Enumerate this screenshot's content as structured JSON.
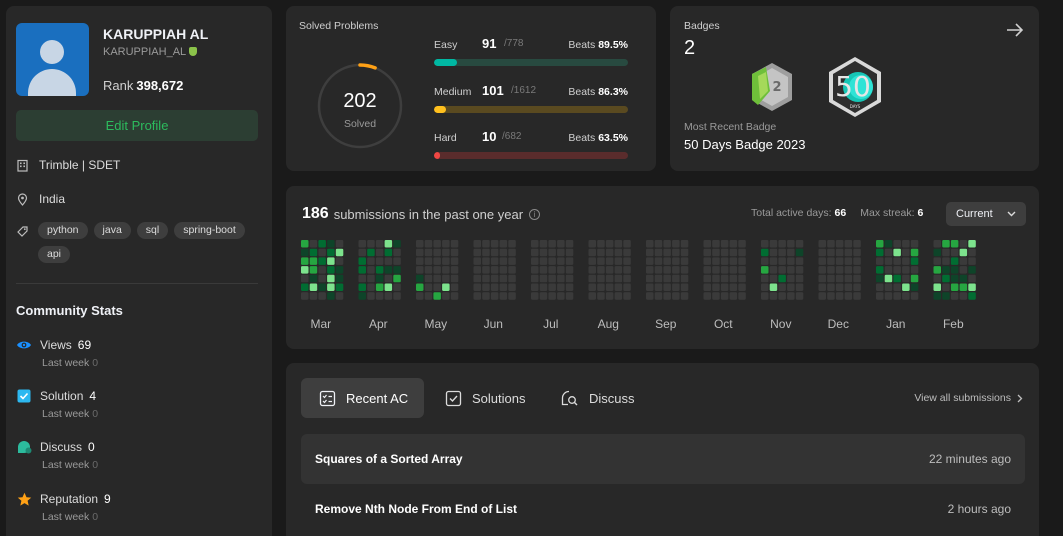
{
  "profile": {
    "name": "KARUPPIAH AL",
    "username": "KARUPPIAH_AL",
    "rank_label": "Rank",
    "rank_value": "398,672",
    "edit_label": "Edit Profile",
    "company": "Trimble | SDET",
    "location": "India",
    "skills": [
      "python",
      "java",
      "sql",
      "spring-boot",
      "api"
    ]
  },
  "community": {
    "title": "Community Stats",
    "last_week_label": "Last week",
    "stats": [
      {
        "label": "Views",
        "value": "69",
        "last_week": "0",
        "icon": "eye-icon",
        "color": "#1a90ff"
      },
      {
        "label": "Solution",
        "value": "4",
        "last_week": "0",
        "icon": "checkbox-icon",
        "color": "#2db8f0"
      },
      {
        "label": "Discuss",
        "value": "0",
        "last_week": "0",
        "icon": "discuss-icon",
        "color": "#2cbb9d"
      },
      {
        "label": "Reputation",
        "value": "9",
        "last_week": "0",
        "icon": "star-icon",
        "color": "#ffa116"
      }
    ]
  },
  "solved": {
    "title": "Solved Problems",
    "total": "202",
    "total_label": "Solved",
    "progress": 0.06,
    "beats_label": "Beats",
    "difficulties": [
      {
        "name": "Easy",
        "solved": "91",
        "total": "/778",
        "beats": "89.5%",
        "fraction": 0.117,
        "color": "#00b8a3",
        "track": "#284a40"
      },
      {
        "name": "Medium",
        "solved": "101",
        "total": "/1612",
        "beats": "86.3%",
        "fraction": 0.063,
        "color": "#ffc01e",
        "track": "#5a4a20"
      },
      {
        "name": "Hard",
        "solved": "10",
        "total": "/682",
        "beats": "63.5%",
        "fraction": 0.015,
        "color": "#ef4743",
        "track": "#5a2c2c"
      }
    ]
  },
  "badges": {
    "title": "Badges",
    "count": "2",
    "recent_label": "Most Recent Badge",
    "recent_name": "50 Days Badge 2023",
    "items": [
      {
        "icon": "annual-badge-icon",
        "text": "2"
      },
      {
        "icon": "fifty-days-badge-icon",
        "text": "50",
        "sub": "DAYS"
      }
    ]
  },
  "calendar": {
    "count": "186",
    "suffix": "submissions in the past one year",
    "active_days_label": "Total active days:",
    "active_days": "66",
    "max_streak_label": "Max streak:",
    "max_streak": "6",
    "selector": "Current",
    "months": [
      "Mar",
      "Apr",
      "May",
      "Jun",
      "Jul",
      "Aug",
      "Sep",
      "Oct",
      "Nov",
      "Dec",
      "Jan",
      "Feb"
    ],
    "colors": {
      "empty": "#3a3a3a",
      "level1": "#0e4429",
      "level2": "#016d32",
      "level3": "#26a641",
      "level4": "#7de38d"
    }
  },
  "activity": {
    "tabs": [
      {
        "label": "Recent AC",
        "icon": "list-check-icon"
      },
      {
        "label": "Solutions",
        "icon": "solution-icon"
      },
      {
        "label": "Discuss",
        "icon": "discuss-search-icon"
      }
    ],
    "view_all": "View all submissions",
    "rows": [
      {
        "title": "Squares of a Sorted Array",
        "time": "22 minutes ago"
      },
      {
        "title": "Remove Nth Node From End of List",
        "time": "2 hours ago"
      }
    ]
  }
}
